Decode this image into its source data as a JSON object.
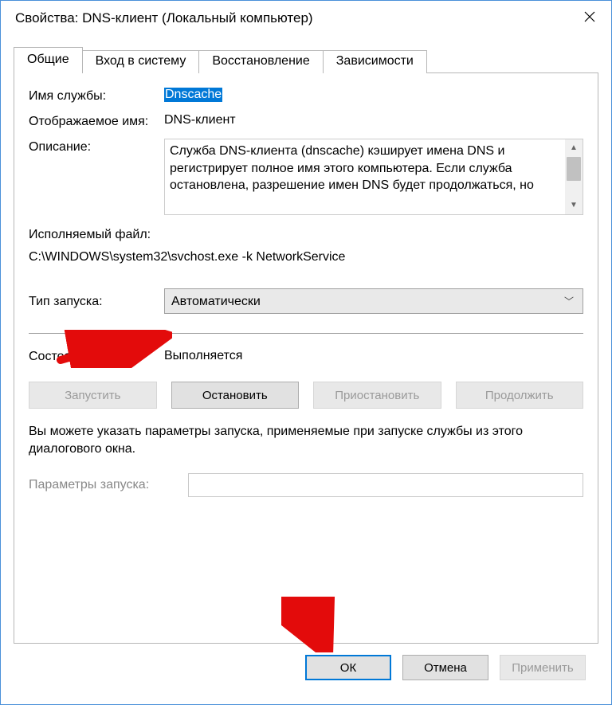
{
  "window": {
    "title": "Свойства: DNS-клиент (Локальный компьютер)"
  },
  "tabs": {
    "general": "Общие",
    "logon": "Вход в систему",
    "recovery": "Восстановление",
    "deps": "Зависимости"
  },
  "general": {
    "service_name_label": "Имя службы:",
    "service_name_value": "Dnscache",
    "display_name_label": "Отображаемое имя:",
    "display_name_value": "DNS-клиент",
    "description_label": "Описание:",
    "description_text": "Служба DNS-клиента (dnscache) кэширует имена DNS и регистрирует полное имя этого компьютера. Если служба остановлена, разрешение имен DNS будет продолжаться, но",
    "exec_label": "Исполняемый файл:",
    "exec_path": "C:\\WINDOWS\\system32\\svchost.exe -k NetworkService",
    "startup_type_label": "Тип запуска:",
    "startup_type_value": "Автоматически",
    "state_label": "Состояние:",
    "state_value": "Выполняется",
    "help_text": "Вы можете указать параметры запуска, применяемые при запуске службы из этого диалогового окна.",
    "params_label": "Параметры запуска:",
    "params_value": ""
  },
  "buttons": {
    "start": "Запустить",
    "stop": "Остановить",
    "pause": "Приостановить",
    "resume": "Продолжить",
    "ok": "ОК",
    "cancel": "Отмена",
    "apply": "Применить"
  }
}
